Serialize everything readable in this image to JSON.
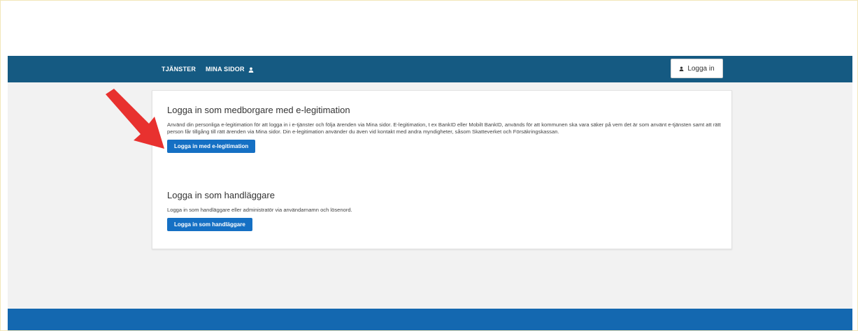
{
  "nav": {
    "tjanster": "TJÄNSTER",
    "mina_sidor": "MINA SIDOR",
    "login_button": "Logga in"
  },
  "section_citizen": {
    "title": "Logga in som medborgare med e-legitimation",
    "text": "Använd din personliga e-legitimation för att logga in i e-tjänster och följa ärenden via Mina sidor.  E-legitimation, t ex BankID eller Mobilt BankID, används för att kommunen ska vara säker på vem det är som använt e-tjänsten samt att rätt person får tillgång till rätt ärenden via Mina sidor. Din e-legitimation använder du även vid kontakt med andra myndigheter, såsom Skatteverket och Försäkringskassan.",
    "button": "Logga in med e-legitimation"
  },
  "section_officer": {
    "title": "Logga in som handläggare",
    "text": "Logga in som handläggare eller administratör via användarnamn och lösenord.",
    "button": "Logga in som handläggare"
  },
  "icons": {
    "user": "user-icon",
    "annotation": "red-arrow-icon"
  },
  "colors": {
    "navbar": "#155a82",
    "footer": "#1468b0",
    "button": "#1570c4",
    "background": "#f2f2f2",
    "arrow": "#e8312f"
  }
}
